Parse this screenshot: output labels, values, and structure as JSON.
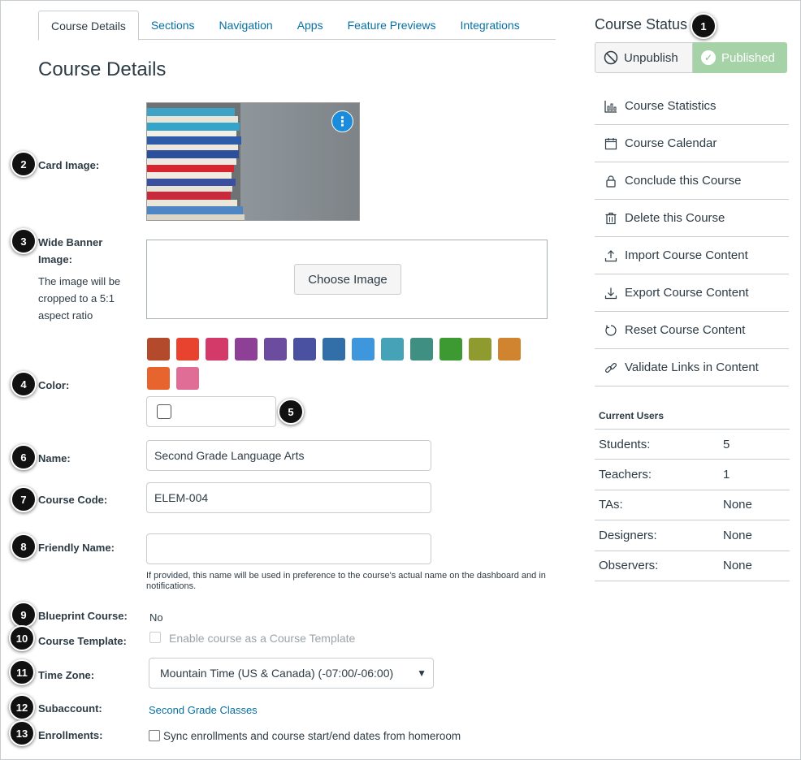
{
  "tabs": [
    {
      "label": "Course Details",
      "active": true
    },
    {
      "label": "Sections"
    },
    {
      "label": "Navigation"
    },
    {
      "label": "Apps"
    },
    {
      "label": "Feature Previews"
    },
    {
      "label": "Integrations"
    }
  ],
  "page_title": "Course Details",
  "callouts": [
    "1",
    "2",
    "3",
    "4",
    "5",
    "6",
    "7",
    "8",
    "9",
    "10",
    "11",
    "12",
    "13"
  ],
  "card_image": {
    "label": "Card Image:",
    "menu_icon": "kebab-vertical-icon"
  },
  "banner": {
    "label_line1": "Wide Banner",
    "label_line2": "Image:",
    "help": "The image will be cropped to a 5:1 aspect ratio",
    "button": "Choose Image"
  },
  "color": {
    "label": "Color:",
    "swatches": [
      "#b24a2b",
      "#e8432f",
      "#d33a6a",
      "#8e3f96",
      "#6b4c9e",
      "#4a51a0",
      "#326ea8",
      "#3e96dd",
      "#46a3b7",
      "#3f8f83",
      "#3d9a32",
      "#8f9a2f",
      "#d18430",
      "#e7642e",
      "#df6d95"
    ]
  },
  "name": {
    "label": "Name:",
    "value": "Second Grade Language Arts"
  },
  "course_code": {
    "label": "Course Code:",
    "value": "ELEM-004"
  },
  "friendly_name": {
    "label": "Friendly Name:",
    "value": "",
    "help": "If provided, this name will be used in preference to the course's actual name on the dashboard and in notifications."
  },
  "blueprint": {
    "label": "Blueprint Course:",
    "value": "No"
  },
  "template": {
    "label": "Course Template:",
    "checkbox_label": "Enable course as a Course Template"
  },
  "timezone": {
    "label": "Time Zone:",
    "value": "Mountain Time (US & Canada) (-07:00/-06:00)"
  },
  "subaccount": {
    "label": "Subaccount:",
    "value": "Second Grade Classes"
  },
  "enrollments": {
    "label": "Enrollments:",
    "checkbox_label": "Sync enrollments and course start/end dates from homeroom"
  },
  "status": {
    "title": "Course Status",
    "unpublish": "Unpublish",
    "published": "Published",
    "published_color": "#a5d3a7"
  },
  "actions": [
    {
      "label": "Course Statistics",
      "icon": "statistics-icon"
    },
    {
      "label": "Course Calendar",
      "icon": "calendar-icon"
    },
    {
      "label": "Conclude this Course",
      "icon": "lock-icon"
    },
    {
      "label": "Delete this Course",
      "icon": "trash-icon"
    },
    {
      "label": "Import Course Content",
      "icon": "upload-icon"
    },
    {
      "label": "Export Course Content",
      "icon": "download-icon"
    },
    {
      "label": "Reset Course Content",
      "icon": "reset-icon"
    },
    {
      "label": "Validate Links in Content",
      "icon": "link-icon"
    }
  ],
  "users": {
    "title": "Current Users",
    "rows": [
      {
        "role": "Students:",
        "count": "5"
      },
      {
        "role": "Teachers:",
        "count": "1"
      },
      {
        "role": "TAs:",
        "count": "None"
      },
      {
        "role": "Designers:",
        "count": "None"
      },
      {
        "role": "Observers:",
        "count": "None"
      }
    ]
  }
}
